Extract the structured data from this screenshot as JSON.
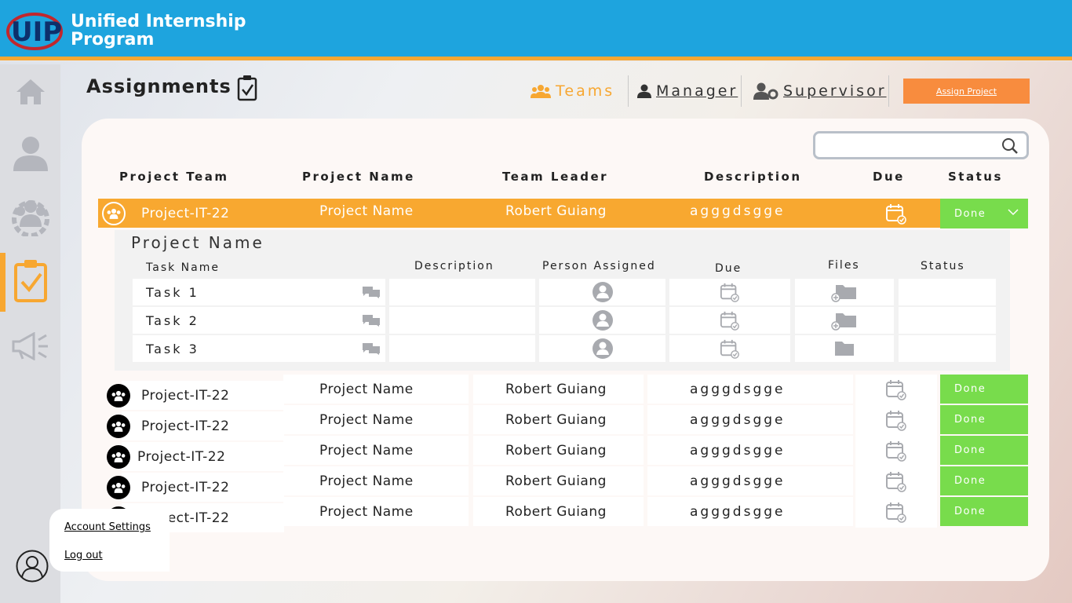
{
  "app": {
    "title_line1": "Unified Internship",
    "title_line2": "Program",
    "logo_text": "UIP"
  },
  "colors": {
    "header": "#1ea4de",
    "accent": "#f7a731",
    "done": "#78dc4c",
    "assign": "#f88c3e"
  },
  "sidebar": {
    "items": [
      {
        "icon": "home-icon",
        "active": false
      },
      {
        "icon": "user-icon",
        "active": false
      },
      {
        "icon": "group-gear-icon",
        "active": false
      },
      {
        "icon": "clipboard-check-icon",
        "active": true
      },
      {
        "icon": "megaphone-icon",
        "active": false
      }
    ]
  },
  "page": {
    "title": "Assignments"
  },
  "nav": {
    "teams": "Teams",
    "manager": "Manager",
    "supervisor": "Supervisor"
  },
  "assign_button": "Assign Project",
  "search": {
    "placeholder": "",
    "value": ""
  },
  "table": {
    "headers": {
      "team": "Project Team",
      "name": "Project Name",
      "leader": "Team Leader",
      "description": "Description",
      "due": "Due",
      "status": "Status"
    },
    "rows": [
      {
        "team": "Project-IT-22",
        "name": "Project Name",
        "leader": "Robert Guiang",
        "description": "agggdsgge",
        "status": "Done"
      },
      {
        "team": "Project-IT-22",
        "name": "Project Name",
        "leader": "Robert Guiang",
        "description": "agggdsgge",
        "status": "Done"
      },
      {
        "team": "Project-IT-22",
        "name": "Project Name",
        "leader": "Robert Guiang",
        "description": "agggdsgge",
        "status": "Done"
      },
      {
        "team": "Project-IT-22",
        "name": "Project Name",
        "leader": "Robert Guiang",
        "description": "agggdsgge",
        "status": "Done"
      },
      {
        "team": "Project-IT-22",
        "name": "Project Name",
        "leader": "Robert Guiang",
        "description": "agggdsgge",
        "status": "Done"
      },
      {
        "team": "Project-IT-22",
        "name": "Project Name",
        "leader": "Robert Guiang",
        "description": "agggdsgge",
        "status": "Done"
      }
    ]
  },
  "expanded": {
    "title": "Project Name",
    "headers": {
      "task": "Task Name",
      "description": "Description",
      "person": "Person Assigned",
      "due": "Due",
      "files": "Files",
      "status": "Status"
    },
    "tasks": [
      {
        "name": "Task 1"
      },
      {
        "name": "Task 2"
      },
      {
        "name": "Task 3"
      }
    ]
  },
  "account_menu": {
    "settings": "Account Settings",
    "logout": "Log out"
  }
}
